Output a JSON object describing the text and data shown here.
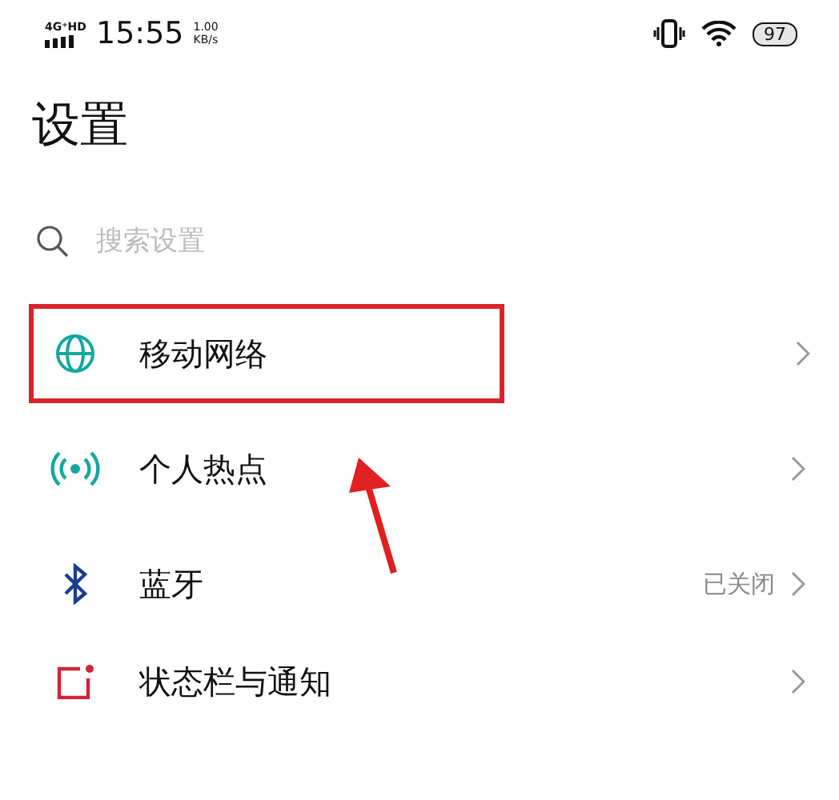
{
  "status_bar": {
    "network": "4G⁺HD",
    "time": "15:55",
    "speed_value": "1.00",
    "speed_unit": "KB/s",
    "battery": "97"
  },
  "title": "设置",
  "search": {
    "placeholder": "搜索设置"
  },
  "items": [
    {
      "kind": "globe",
      "label": "移动网络",
      "value": "",
      "highlighted": true
    },
    {
      "kind": "hotspot",
      "label": "个人热点",
      "value": "",
      "highlighted": false
    },
    {
      "kind": "bluetooth",
      "label": "蓝牙",
      "value": "已关闭",
      "highlighted": false
    },
    {
      "kind": "statusbar",
      "label": "状态栏与通知",
      "value": "",
      "highlighted": false
    }
  ]
}
